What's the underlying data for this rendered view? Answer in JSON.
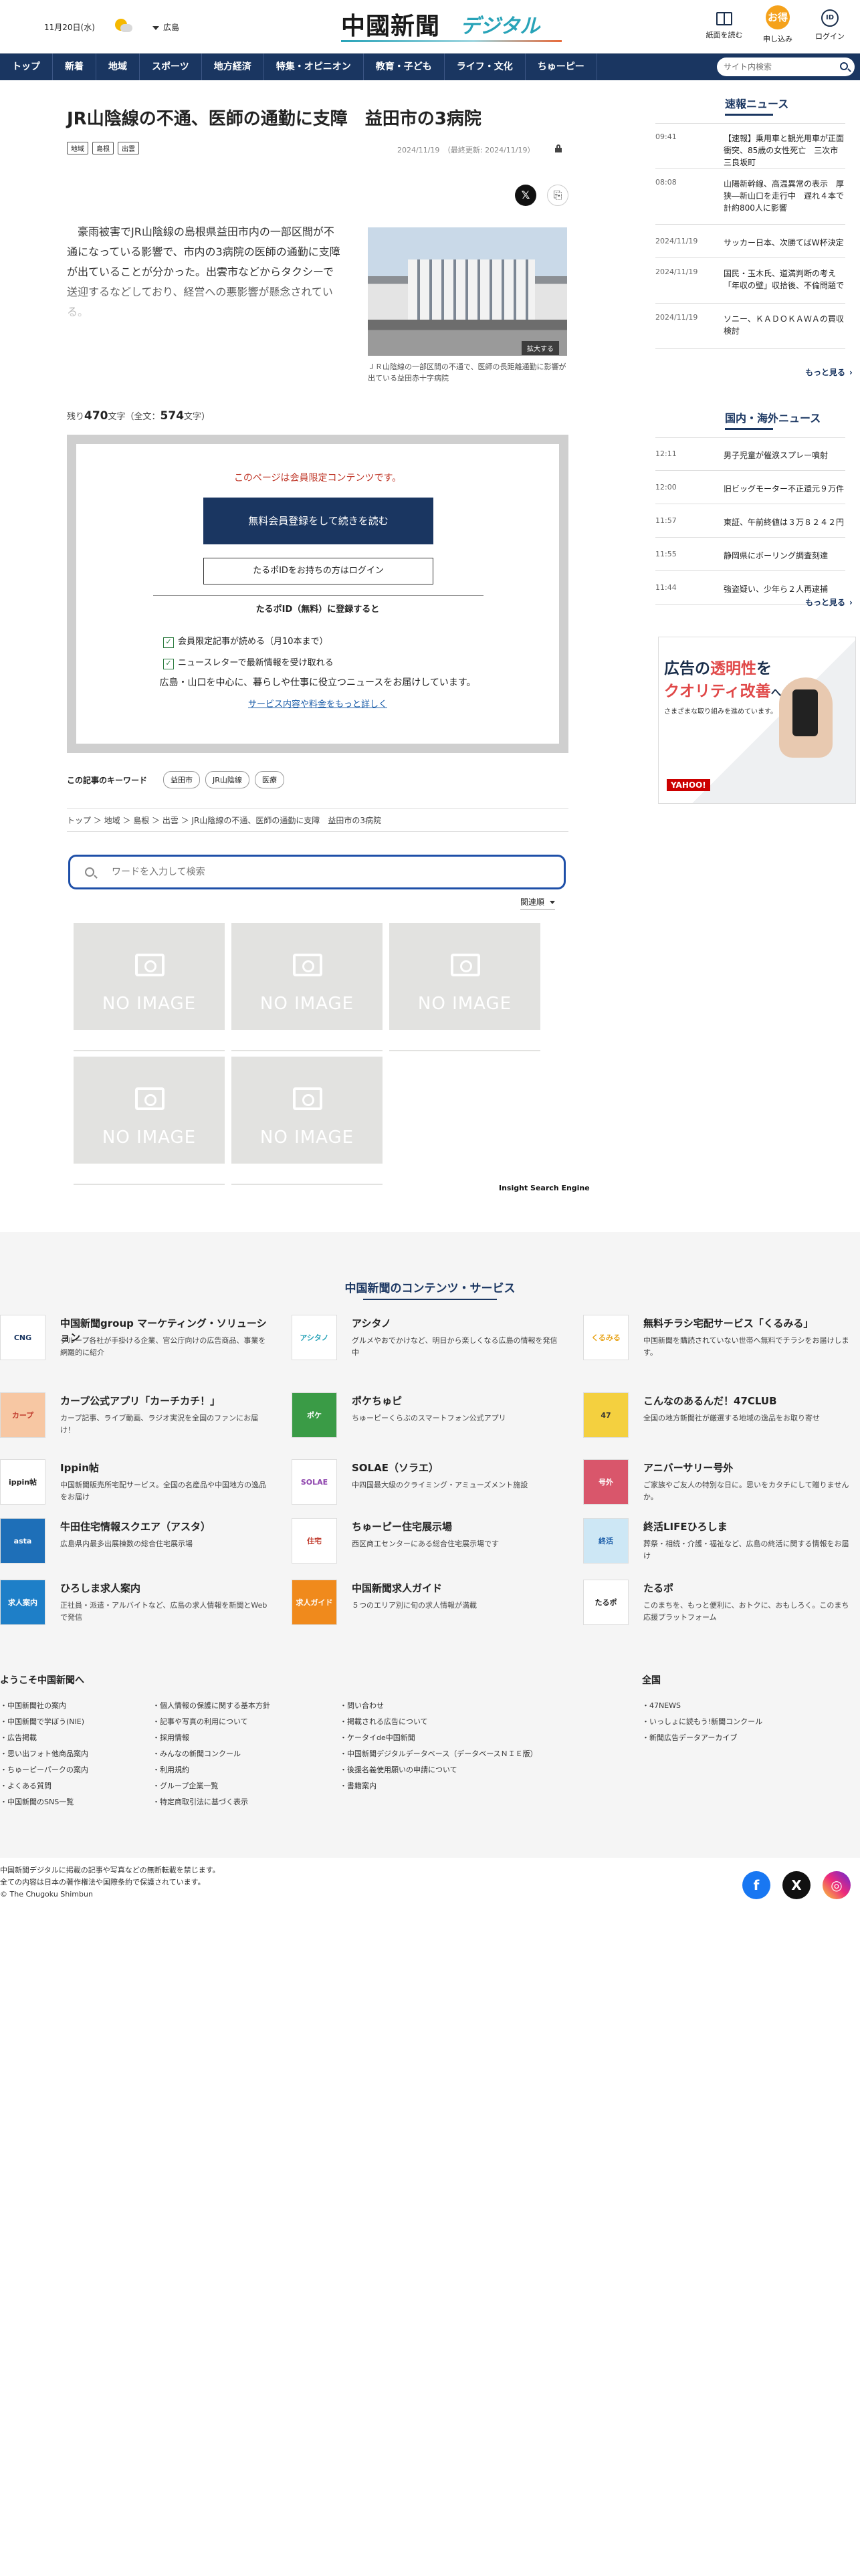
{
  "header": {
    "date": "11月20日(水)",
    "region": "広島",
    "logo_main": "中國新聞",
    "logo_sub": "デジタル",
    "tools": [
      {
        "label": "紙面を読む"
      },
      {
        "label": "申し込み",
        "icon_text": "お得"
      },
      {
        "label": "ログイン",
        "icon_text": "ID"
      }
    ]
  },
  "nav": {
    "items": [
      "トップ",
      "新着",
      "地域",
      "スポーツ",
      "地方経済",
      "特集・オピニオン",
      "教育・子ども",
      "ライフ・文化",
      "ちゅーピー"
    ],
    "search_placeholder": "サイト内検索"
  },
  "article": {
    "title": "JR山陰線の不通、医師の通勤に支障　益田市の3病院",
    "tags": [
      "地域",
      "島根",
      "出雲"
    ],
    "date": "2024/11/19　（最終更新: 2024/11/19）",
    "lead": "豪雨被害でJR山陰線の島根県益田市内の一部区間が不通になっている影響で、市内の3病院の医師の通勤に支障が出ていることが分かった。出雲市などからタクシーで送迎するなどしており、経営への悪影響が懸念されている。",
    "photo_zoom": "拡大する",
    "photo_caption": "ＪＲ山陰線の一部区間の不通で、医師の長距離通勤に影響が出ている益田赤十字病院",
    "remaining_prefix": "残り",
    "remaining": "470",
    "total_prefix": "文字（全文：",
    "total": "574",
    "total_suffix": "文字）"
  },
  "paywall": {
    "message": "このページは会員限定コンテンツです。",
    "register_button": "無料会員登録をして続きを読む",
    "login_button": "たるポIDをお持ちの方はログイン",
    "heading": "たるポID（無料）に登録すると",
    "benefits": [
      "会員限定記事が読める（月10本まで）",
      "ニュースレターで最新情報を受け取れる"
    ],
    "description": "広島・山口を中心に、暮らしや仕事に役立つニュースをお届けしています。",
    "more_link": "サービス内容や料金をもっと詳しく"
  },
  "keywords": {
    "label": "この記事のキーワード",
    "items": [
      "益田市",
      "JR山陰線",
      "医療"
    ]
  },
  "breadcrumb": "トップ ＞ 地域 ＞ 島根 ＞ 出雲 ＞ JR山陰線の不通、医師の通勤に支障　益田市の3病院",
  "insight": {
    "placeholder": "ワードを入力して検索",
    "sort": "関連順",
    "no_image": "NO IMAGE",
    "engine": "Insight Search Engine"
  },
  "sidebar": {
    "flash_title": "速報ニュース",
    "flash": [
      {
        "time": "09:41",
        "text": "【速報】乗用車と観光用車が正面衝突、85歳の女性死亡　三次市三良坂町"
      },
      {
        "time": "08:08",
        "text": "山陽新幹線、高温異常の表示　厚狭―新山口を走行中　遅れ４本で計約800人に影響"
      },
      {
        "time": "2024/11/19",
        "text": "サッカー日本、次勝てばW杯決定"
      },
      {
        "time": "2024/11/19",
        "text": "国民・玉木氏、道満判断の考え「年収の壁」収拾後、不倫問題で"
      },
      {
        "time": "2024/11/19",
        "text": "ソニー、ＫＡＤＯＫＡＷＡの買収検討"
      }
    ],
    "more": "もっと見る",
    "world_title": "国内・海外ニュース",
    "world": [
      {
        "time": "12:11",
        "text": "男子児童が催涙スプレー噴射"
      },
      {
        "time": "12:00",
        "text": "旧ビッグモーター不正還元９万件"
      },
      {
        "time": "11:57",
        "text": "東証、午前終値は３万８２４２円"
      },
      {
        "time": "11:55",
        "text": "静岡県にボーリング調査刻達"
      },
      {
        "time": "11:44",
        "text": "強盗疑い、少年ら２人再逮捕"
      }
    ],
    "ad": {
      "headline_1": "広告の",
      "headline_em": "透明性",
      "headline_2": "を",
      "headline_3": "クオリティ改善",
      "headline_4": "への",
      "sub": "さまざまな取り組みを進めています。",
      "brand": "YAHOO!"
    }
  },
  "services": {
    "heading": "中国新聞のコンテンツ・サービス",
    "items": [
      {
        "name": "中国新聞group マーケティング・ソリューション",
        "desc": "グループ各社が手掛ける企業、官公庁向けの広告商品、事業を網羅的に紹介",
        "logo": "CNG"
      },
      {
        "name": "アシタノ",
        "desc": "グルメやおでかけなど、明日から楽しくなる広島の情報を発信中",
        "logo": "アシタノ"
      },
      {
        "name": "無料チラシ宅配サービス「くるみる」",
        "desc": "中国新聞を購読されていない世帯へ無料でチラシをお届けします。",
        "logo": "くるみる"
      },
      {
        "name": "カープ公式アプリ「カーチカチ！」",
        "desc": "カープ記事、ライブ動画、ラジオ実況を全国のファンにお届け！",
        "logo": "カープ"
      },
      {
        "name": "ポケちゅピ",
        "desc": "ちゅーピーくらぶのスマートフォン公式アプリ",
        "logo": "ポケ"
      },
      {
        "name": "こんなのあるんだ！47CLUB",
        "desc": "全国の地方新聞社が厳選する地域の逸品をお取り寄せ",
        "logo": "47"
      },
      {
        "name": "Ippin帖",
        "desc": "中国新聞販売所宅配サービス。全国の名産品や中国地方の逸品をお届け",
        "logo": "ippin帖"
      },
      {
        "name": "SOLAE（ソラエ）",
        "desc": "中四国最大級のクライミング・アミューズメント施設",
        "logo": "SOLAE"
      },
      {
        "name": "アニバーサリー号外",
        "desc": "ご家族やご友人の特別な日に。思いをカタチにして贈りませんか。",
        "logo": "号外"
      },
      {
        "name": "牛田住宅情報スクエア（アスタ）",
        "desc": "広島県内最多出展棟数の総合住宅展示場",
        "logo": "asta"
      },
      {
        "name": "ちゅーピー住宅展示場",
        "desc": "西区商工センターにある総合住宅展示場です",
        "logo": "住宅"
      },
      {
        "name": "終活LIFEひろしま",
        "desc": "葬祭・相続・介護・福祉など、広島の終活に関する情報をお届け",
        "logo": "終活"
      },
      {
        "name": "ひろしま求人案内",
        "desc": "正社員・派遣・アルバイトなど、広島の求人情報を新聞とWebで発信",
        "logo": "求人案内"
      },
      {
        "name": "中国新聞求人ガイド",
        "desc": "５つのエリア別に旬の求人情報が満載",
        "logo": "求人ガイド"
      },
      {
        "name": "たるポ",
        "desc": "このまちを、もっと便利に、おトクに、おもしろく。このまち応援プラットフォーム",
        "logo": "たるポ"
      }
    ]
  },
  "footer": {
    "welcome_heading": "ようこそ中国新聞へ",
    "col1": [
      "中国新聞社の案内",
      "中国新聞で学ぼう(NIE)",
      "広告掲載",
      "思い出フォト他商品案内",
      "ちゅーピーパークの案内",
      "よくある質問",
      "中国新聞のSNS一覧"
    ],
    "col2": [
      "個人情報の保護に関する基本方針",
      "記事や写真の利用について",
      "採用情報",
      "みんなの新聞コンクール",
      "利用規約",
      "グループ企業一覧",
      "特定商取引法に基づく表示"
    ],
    "col3": [
      "問い合わせ",
      "掲載される広告について",
      "ケータイde中国新聞",
      "中国新聞デジタルデータベース（データベースＮＩＥ版）",
      "後援名義使用願いの申請について",
      "書籍案内"
    ],
    "national_heading": "全国",
    "col4": [
      "47NEWS",
      "いっしょに読もう!新聞コンクール",
      "新聞広告データアーカイブ"
    ],
    "copy1": "中国新聞デジタルに掲載の記事や写真などの無断転載を禁じます。",
    "copy2": "全ての内容は日本の著作権法や国際条約で保護されています。",
    "copy3": "© The Chugoku Shimbun",
    "social": [
      "f",
      "X",
      "◎"
    ]
  }
}
